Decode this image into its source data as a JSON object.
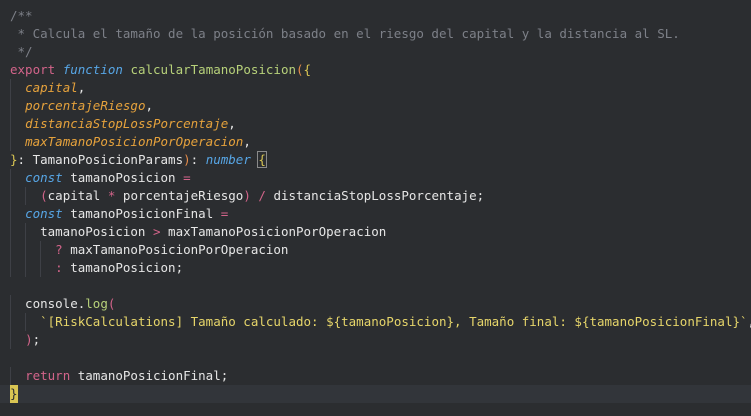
{
  "editor": {
    "lines": [
      {
        "indent": 0,
        "tokens": [
          {
            "t": "/**",
            "c": "comment"
          }
        ]
      },
      {
        "indent": 0,
        "tokens": [
          {
            "t": " * Calcula el tamaño de la posición basado en el riesgo del capital y la distancia al SL.",
            "c": "comment"
          }
        ]
      },
      {
        "indent": 0,
        "tokens": [
          {
            "t": " */",
            "c": "comment"
          }
        ]
      },
      {
        "indent": 0,
        "tokens": [
          {
            "t": "export",
            "c": "keyword"
          },
          {
            "t": " ",
            "c": "plain"
          },
          {
            "t": "function",
            "c": "fn-kw"
          },
          {
            "t": " ",
            "c": "plain"
          },
          {
            "t": "calcularTamanoPosicion",
            "c": "fn-name"
          },
          {
            "t": "(",
            "c": "paren"
          },
          {
            "t": "{",
            "c": "brace"
          }
        ]
      },
      {
        "indent": 1,
        "tokens": [
          {
            "t": "  ",
            "c": "plain"
          },
          {
            "t": "capital",
            "c": "param"
          },
          {
            "t": ",",
            "c": "plain"
          }
        ]
      },
      {
        "indent": 1,
        "tokens": [
          {
            "t": "  ",
            "c": "plain"
          },
          {
            "t": "porcentajeRiesgo",
            "c": "param"
          },
          {
            "t": ",",
            "c": "plain"
          }
        ]
      },
      {
        "indent": 1,
        "tokens": [
          {
            "t": "  ",
            "c": "plain"
          },
          {
            "t": "distanciaStopLossPorcentaje",
            "c": "param"
          },
          {
            "t": ",",
            "c": "plain"
          }
        ]
      },
      {
        "indent": 1,
        "tokens": [
          {
            "t": "  ",
            "c": "plain"
          },
          {
            "t": "maxTamanoPosicionPorOperacion",
            "c": "param"
          },
          {
            "t": ",",
            "c": "plain"
          }
        ]
      },
      {
        "indent": 0,
        "tokens": [
          {
            "t": "}",
            "c": "brace"
          },
          {
            "t": ": ",
            "c": "plain"
          },
          {
            "t": "TamanoPosicionParams",
            "c": "type"
          },
          {
            "t": ")",
            "c": "paren"
          },
          {
            "t": ": ",
            "c": "plain"
          },
          {
            "t": "number",
            "c": "prim"
          },
          {
            "t": " ",
            "c": "plain"
          },
          {
            "t": "{",
            "c": "brace-match"
          }
        ]
      },
      {
        "indent": 1,
        "tokens": [
          {
            "t": "  ",
            "c": "plain"
          },
          {
            "t": "const",
            "c": "const"
          },
          {
            "t": " tamanoPosicion ",
            "c": "plain"
          },
          {
            "t": "=",
            "c": "op"
          }
        ]
      },
      {
        "indent": 2,
        "tokens": [
          {
            "t": "    ",
            "c": "plain"
          },
          {
            "t": "(",
            "c": "lparen"
          },
          {
            "t": "capital ",
            "c": "plain"
          },
          {
            "t": "*",
            "c": "op"
          },
          {
            "t": " porcentajeRiesgo",
            "c": "plain"
          },
          {
            "t": ")",
            "c": "lparen"
          },
          {
            "t": " ",
            "c": "plain"
          },
          {
            "t": "/",
            "c": "op"
          },
          {
            "t": " distanciaStopLossPorcentaje;",
            "c": "plain"
          }
        ]
      },
      {
        "indent": 1,
        "tokens": [
          {
            "t": "  ",
            "c": "plain"
          },
          {
            "t": "const",
            "c": "const"
          },
          {
            "t": " tamanoPosicionFinal ",
            "c": "plain"
          },
          {
            "t": "=",
            "c": "op"
          }
        ]
      },
      {
        "indent": 2,
        "tokens": [
          {
            "t": "    tamanoPosicion ",
            "c": "plain"
          },
          {
            "t": ">",
            "c": "op"
          },
          {
            "t": " maxTamanoPosicionPorOperacion",
            "c": "plain"
          }
        ]
      },
      {
        "indent": 3,
        "tokens": [
          {
            "t": "      ",
            "c": "plain"
          },
          {
            "t": "?",
            "c": "op"
          },
          {
            "t": " maxTamanoPosicionPorOperacion",
            "c": "plain"
          }
        ]
      },
      {
        "indent": 3,
        "tokens": [
          {
            "t": "      ",
            "c": "plain"
          },
          {
            "t": ":",
            "c": "op"
          },
          {
            "t": " tamanoPosicion;",
            "c": "plain"
          }
        ]
      },
      {
        "indent": 0,
        "tokens": [
          {
            "t": "",
            "c": "plain"
          }
        ]
      },
      {
        "indent": 1,
        "tokens": [
          {
            "t": "  console.",
            "c": "plain"
          },
          {
            "t": "log",
            "c": "method"
          },
          {
            "t": "(",
            "c": "lparen"
          }
        ]
      },
      {
        "indent": 2,
        "tokens": [
          {
            "t": "    ",
            "c": "plain"
          },
          {
            "t": "`[RiskCalculations] Tamaño calculado: ${tamanoPosicion}, Tamaño final: ${tamanoPosicionFinal}`",
            "c": "str"
          },
          {
            "t": ",",
            "c": "plain"
          }
        ]
      },
      {
        "indent": 1,
        "tokens": [
          {
            "t": "  ",
            "c": "plain"
          },
          {
            "t": ")",
            "c": "lparen"
          },
          {
            "t": ";",
            "c": "plain"
          }
        ]
      },
      {
        "indent": 0,
        "tokens": [
          {
            "t": "",
            "c": "plain"
          }
        ]
      },
      {
        "indent": 1,
        "tokens": [
          {
            "t": "  ",
            "c": "plain"
          },
          {
            "t": "return",
            "c": "ret"
          },
          {
            "t": " tamanoPosicionFinal;",
            "c": "plain"
          }
        ]
      },
      {
        "indent": 0,
        "active": true,
        "tokens": [
          {
            "t": "}",
            "c": "cursor-brace"
          }
        ]
      }
    ]
  },
  "colors": {
    "background": "#2b2d30",
    "comment": "#7d8088",
    "keyword": "#d3648a",
    "function_keyword": "#57a6e6",
    "function_name": "#b7d17a",
    "brace": "#d9c553",
    "parameter": "#e6a23c",
    "string": "#e6d56a"
  }
}
